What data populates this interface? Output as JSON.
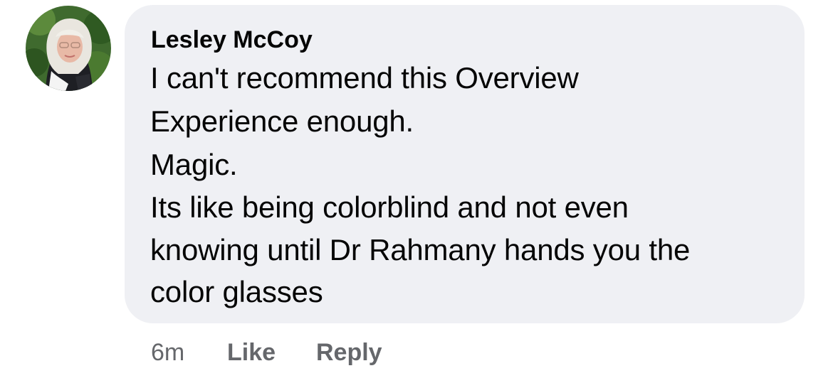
{
  "comment": {
    "author": "Lesley McCoy",
    "lines": [
      "I can't recommend this Overview",
      "Experience enough.",
      "Magic.",
      "Its like being colorblind and not even",
      "knowing until Dr Rahmany hands you the",
      "color glasses"
    ],
    "timestamp": "6m",
    "like_label": "Like",
    "reply_label": "Reply"
  },
  "colors": {
    "bubble_background": "#eff0f4",
    "meta_text": "#65676b",
    "primary_text": "#050505"
  },
  "icons": {
    "avatar": "profile-photo-avatar"
  }
}
